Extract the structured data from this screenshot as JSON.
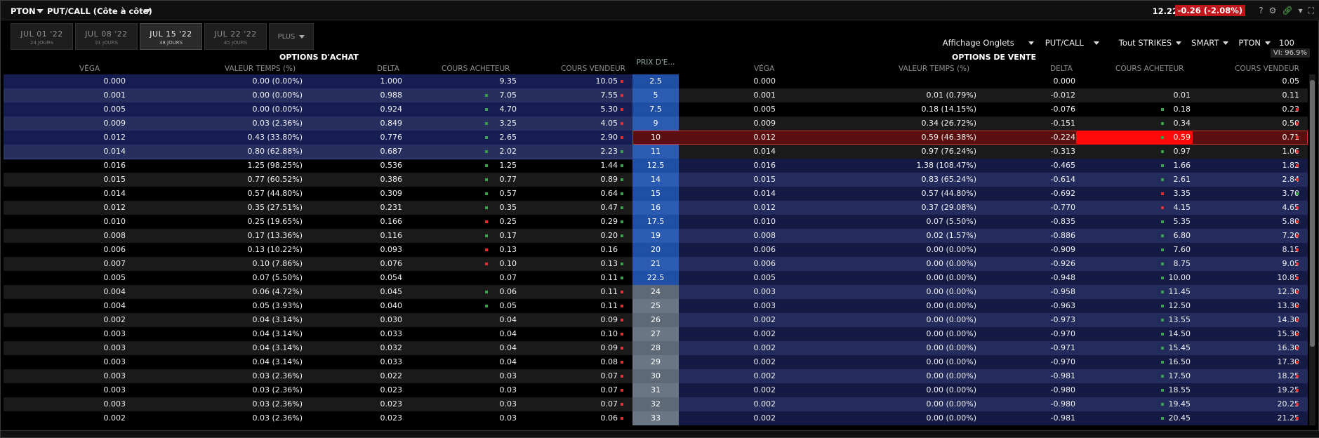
{
  "titlebar": {
    "symbol": "PTON",
    "view": "PUT/CALL (Côte à côte)",
    "last": "12.22",
    "change": "-0.26 (-2.08%)",
    "help": "?"
  },
  "tabs": [
    {
      "label": "JUL 01 '22",
      "days": "24 JOURS",
      "active": false
    },
    {
      "label": "JUL 08 '22",
      "days": "31 JOURS",
      "active": false
    },
    {
      "label": "JUL 15 '22",
      "days": "38 JOURS",
      "active": true
    },
    {
      "label": "JUL 22 '22",
      "days": "45 JOURS",
      "active": false
    }
  ],
  "more_label": "PLUS",
  "toolbar": {
    "affichage": "Affichage Onglets",
    "putcall": "PUT/CALL",
    "strikes": "Tout STRIKES",
    "exchange": "SMART",
    "underlying": "PTON",
    "qty": "100",
    "vi": "VI: 96.9%"
  },
  "headers": {
    "calls_title": "OPTIONS D'ACHAT",
    "puts_title": "OPTIONS DE VENTE",
    "strike": "PRIX D'E...",
    "vega": "VÉGA",
    "time_value": "VALEUR TEMPS (%)",
    "delta": "DELTA",
    "bid": "COURS ACHETEUR",
    "ask": "COURS VENDEUR"
  },
  "colors": {
    "atm_blue": "#2a4fa8",
    "otm_gray": "#65707c",
    "loss_red": "#c0151a",
    "highlight": "#ff0a0a"
  },
  "rows": [
    {
      "strike": "2.5",
      "cv": "0.000",
      "ctv": "0.00 (0.00%)",
      "cd": "1.000",
      "cb": "9.35",
      "ca": "10.05",
      "cbm": "",
      "cam": "r",
      "pv": "0.000",
      "ptv": "",
      "pd": "0.000",
      "pb": "",
      "pa": "0.05",
      "pbm": "",
      "pam": ""
    },
    {
      "strike": "5",
      "cv": "0.001",
      "ctv": "0.00 (0.00%)",
      "cd": "0.988",
      "cb": "7.05",
      "ca": "7.55",
      "cbm": "g",
      "cam": "r",
      "pv": "0.001",
      "ptv": "0.01 (0.79%)",
      "pd": "-0.012",
      "pb": "0.01",
      "pa": "0.11",
      "pbm": "",
      "pam": ""
    },
    {
      "strike": "7.5",
      "cv": "0.005",
      "ctv": "0.00 (0.00%)",
      "cd": "0.924",
      "cb": "4.70",
      "ca": "5.30",
      "cbm": "g",
      "cam": "r",
      "pv": "0.005",
      "ptv": "0.18 (14.15%)",
      "pd": "-0.076",
      "pb": "0.18",
      "pa": "0.23",
      "pbm": "g",
      "pam": "r"
    },
    {
      "strike": "9",
      "cv": "0.009",
      "ctv": "0.03 (2.36%)",
      "cd": "0.849",
      "cb": "3.25",
      "ca": "4.05",
      "cbm": "g",
      "cam": "r",
      "pv": "0.009",
      "ptv": "0.34 (26.72%)",
      "pd": "-0.151",
      "pb": "0.34",
      "pa": "0.50",
      "pbm": "g",
      "pam": "r"
    },
    {
      "strike": "10",
      "cv": "0.012",
      "ctv": "0.43 (33.80%)",
      "cd": "0.776",
      "cb": "2.65",
      "ca": "2.90",
      "cbm": "g",
      "cam": "r",
      "pv": "0.012",
      "ptv": "0.59 (46.38%)",
      "pd": "-0.224",
      "pb": "0.59",
      "pa": "0.71",
      "pbm": "g",
      "pam": "r"
    },
    {
      "strike": "11",
      "cv": "0.014",
      "ctv": "0.80 (62.88%)",
      "cd": "0.687",
      "cb": "2.02",
      "ca": "2.23",
      "cbm": "g",
      "cam": "g",
      "pv": "0.014",
      "ptv": "0.97 (76.24%)",
      "pd": "-0.313",
      "pb": "0.97",
      "pa": "1.06",
      "pbm": "g",
      "pam": "r"
    },
    {
      "strike": "12.5",
      "cv": "0.016",
      "ctv": "1.25 (98.25%)",
      "cd": "0.536",
      "cb": "1.25",
      "ca": "1.44",
      "cbm": "g",
      "cam": "g",
      "pv": "0.016",
      "ptv": "1.38 (108.47%)",
      "pd": "-0.465",
      "pb": "1.66",
      "pa": "1.82",
      "pbm": "g",
      "pam": "r"
    },
    {
      "strike": "14",
      "cv": "0.015",
      "ctv": "0.77 (60.52%)",
      "cd": "0.386",
      "cb": "0.77",
      "ca": "0.89",
      "cbm": "g",
      "cam": "g",
      "pv": "0.015",
      "ptv": "0.83 (65.24%)",
      "pd": "-0.614",
      "pb": "2.61",
      "pa": "2.84",
      "pbm": "g",
      "pam": "r"
    },
    {
      "strike": "15",
      "cv": "0.014",
      "ctv": "0.57 (44.80%)",
      "cd": "0.309",
      "cb": "0.57",
      "ca": "0.64",
      "cbm": "g",
      "cam": "g",
      "pv": "0.014",
      "ptv": "0.57 (44.80%)",
      "pd": "-0.692",
      "pb": "3.35",
      "pa": "3.70",
      "pbm": "rd",
      "pam": "g"
    },
    {
      "strike": "16",
      "cv": "0.012",
      "ctv": "0.35 (27.51%)",
      "cd": "0.231",
      "cb": "0.35",
      "ca": "0.47",
      "cbm": "g",
      "cam": "g",
      "pv": "0.012",
      "ptv": "0.37 (29.08%)",
      "pd": "-0.770",
      "pb": "4.15",
      "pa": "4.65",
      "pbm": "rd",
      "pam": "r"
    },
    {
      "strike": "17.5",
      "cv": "0.010",
      "ctv": "0.25 (19.65%)",
      "cd": "0.166",
      "cb": "0.25",
      "ca": "0.29",
      "cbm": "rd",
      "cam": "g",
      "pv": "0.010",
      "ptv": "0.07 (5.50%)",
      "pd": "-0.835",
      "pb": "5.35",
      "pa": "5.80",
      "pbm": "g",
      "pam": "r"
    },
    {
      "strike": "19",
      "cv": "0.008",
      "ctv": "0.17 (13.36%)",
      "cd": "0.116",
      "cb": "0.17",
      "ca": "0.20",
      "cbm": "g",
      "cam": "g",
      "pv": "0.008",
      "ptv": "0.02 (1.57%)",
      "pd": "-0.886",
      "pb": "6.80",
      "pa": "7.20",
      "pbm": "g",
      "pam": "r"
    },
    {
      "strike": "20",
      "cv": "0.006",
      "ctv": "0.13 (10.22%)",
      "cd": "0.093",
      "cb": "0.13",
      "ca": "0.16",
      "cbm": "rd",
      "cam": "",
      "pv": "0.006",
      "ptv": "0.00 (0.00%)",
      "pd": "-0.909",
      "pb": "7.60",
      "pa": "8.15",
      "pbm": "g",
      "pam": "r"
    },
    {
      "strike": "21",
      "cv": "0.007",
      "ctv": "0.10 (7.86%)",
      "cd": "0.076",
      "cb": "0.10",
      "ca": "0.13",
      "cbm": "rd",
      "cam": "g",
      "pv": "0.006",
      "ptv": "0.00 (0.00%)",
      "pd": "-0.926",
      "pb": "8.75",
      "pa": "9.05",
      "pbm": "g",
      "pam": "r"
    },
    {
      "strike": "22.5",
      "cv": "0.005",
      "ctv": "0.07 (5.50%)",
      "cd": "0.054",
      "cb": "0.07",
      "ca": "0.11",
      "cbm": "",
      "cam": "g",
      "pv": "0.005",
      "ptv": "0.00 (0.00%)",
      "pd": "-0.948",
      "pb": "10.00",
      "pa": "10.85",
      "pbm": "g",
      "pam": "r"
    },
    {
      "strike": "24",
      "cv": "0.004",
      "ctv": "0.06 (4.72%)",
      "cd": "0.045",
      "cb": "0.06",
      "ca": "0.11",
      "cbm": "g",
      "cam": "r",
      "pv": "0.003",
      "ptv": "0.00 (0.00%)",
      "pd": "-0.958",
      "pb": "11.45",
      "pa": "12.30",
      "pbm": "g",
      "pam": "r"
    },
    {
      "strike": "25",
      "cv": "0.004",
      "ctv": "0.05 (3.93%)",
      "cd": "0.040",
      "cb": "0.05",
      "ca": "0.11",
      "cbm": "g",
      "cam": "r",
      "pv": "0.003",
      "ptv": "0.00 (0.00%)",
      "pd": "-0.963",
      "pb": "12.50",
      "pa": "13.30",
      "pbm": "g",
      "pam": "r"
    },
    {
      "strike": "26",
      "cv": "0.002",
      "ctv": "0.04 (3.14%)",
      "cd": "0.030",
      "cb": "0.04",
      "ca": "0.09",
      "cbm": "",
      "cam": "r",
      "pv": "0.002",
      "ptv": "0.00 (0.00%)",
      "pd": "-0.973",
      "pb": "13.55",
      "pa": "14.30",
      "pbm": "g",
      "pam": "r"
    },
    {
      "strike": "27",
      "cv": "0.003",
      "ctv": "0.04 (3.14%)",
      "cd": "0.033",
      "cb": "0.04",
      "ca": "0.10",
      "cbm": "",
      "cam": "r",
      "pv": "0.002",
      "ptv": "0.00 (0.00%)",
      "pd": "-0.970",
      "pb": "14.50",
      "pa": "15.30",
      "pbm": "g",
      "pam": "r"
    },
    {
      "strike": "28",
      "cv": "0.003",
      "ctv": "0.04 (3.14%)",
      "cd": "0.032",
      "cb": "0.04",
      "ca": "0.09",
      "cbm": "",
      "cam": "r",
      "pv": "0.002",
      "ptv": "0.00 (0.00%)",
      "pd": "-0.971",
      "pb": "15.45",
      "pa": "16.30",
      "pbm": "g",
      "pam": "r"
    },
    {
      "strike": "29",
      "cv": "0.003",
      "ctv": "0.04 (3.14%)",
      "cd": "0.033",
      "cb": "0.04",
      "ca": "0.08",
      "cbm": "",
      "cam": "r",
      "pv": "0.002",
      "ptv": "0.00 (0.00%)",
      "pd": "-0.970",
      "pb": "16.50",
      "pa": "17.30",
      "pbm": "g",
      "pam": "r"
    },
    {
      "strike": "30",
      "cv": "0.003",
      "ctv": "0.03 (2.36%)",
      "cd": "0.022",
      "cb": "0.03",
      "ca": "0.07",
      "cbm": "",
      "cam": "r",
      "pv": "0.002",
      "ptv": "0.00 (0.00%)",
      "pd": "-0.981",
      "pb": "17.50",
      "pa": "18.25",
      "pbm": "g",
      "pam": "r"
    },
    {
      "strike": "31",
      "cv": "0.003",
      "ctv": "0.03 (2.36%)",
      "cd": "0.023",
      "cb": "0.03",
      "ca": "0.07",
      "cbm": "",
      "cam": "r",
      "pv": "0.002",
      "ptv": "0.00 (0.00%)",
      "pd": "-0.980",
      "pb": "18.55",
      "pa": "19.25",
      "pbm": "g",
      "pam": "r"
    },
    {
      "strike": "32",
      "cv": "0.003",
      "ctv": "0.03 (2.36%)",
      "cd": "0.023",
      "cb": "0.03",
      "ca": "0.07",
      "cbm": "",
      "cam": "r",
      "pv": "0.002",
      "ptv": "0.00 (0.00%)",
      "pd": "-0.980",
      "pb": "19.45",
      "pa": "20.25",
      "pbm": "g",
      "pam": "r"
    },
    {
      "strike": "33",
      "cv": "0.002",
      "ctv": "0.03 (2.36%)",
      "cd": "0.023",
      "cb": "0.03",
      "ca": "0.06",
      "cbm": "",
      "cam": "r",
      "pv": "0.002",
      "ptv": "0.00 (0.00%)",
      "pd": "-0.981",
      "pb": "20.45",
      "pa": "21.25",
      "pbm": "g",
      "pam": "r"
    }
  ]
}
